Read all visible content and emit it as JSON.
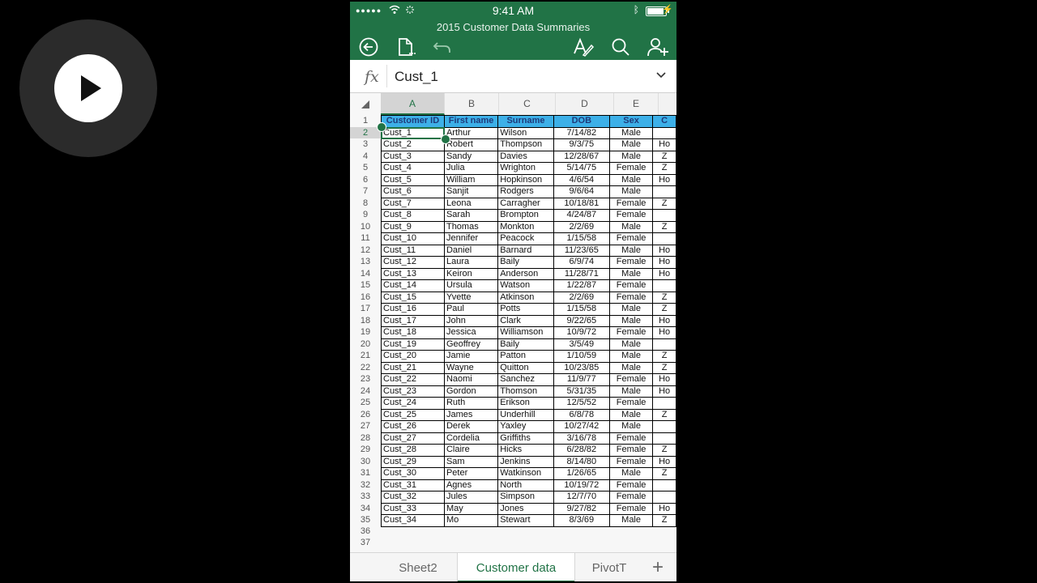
{
  "status": {
    "time": "9:41 AM",
    "signal": "●●●●●"
  },
  "document": {
    "title": "2015 Customer Data Summaries"
  },
  "toolbar": {
    "back": "back-arrow-icon",
    "file": "file-icon",
    "undo": "undo-icon",
    "format": "format-text-icon",
    "search": "search-icon",
    "share": "add-person-icon"
  },
  "formula_bar": {
    "fx_label": "fx",
    "value": "Cust_1"
  },
  "grid": {
    "columns": [
      "A",
      "B",
      "C",
      "D",
      "E",
      ""
    ],
    "header_row": [
      "Customer ID",
      "First name",
      "Surname",
      "DOB",
      "Sex",
      "C"
    ],
    "rows": [
      [
        "Cust_1",
        "Arthur",
        "Wilson",
        "7/14/82",
        "Male",
        ""
      ],
      [
        "Cust_2",
        "Robert",
        "Thompson",
        "9/3/75",
        "Male",
        "Ho"
      ],
      [
        "Cust_3",
        "Sandy",
        "Davies",
        "12/28/67",
        "Male",
        "Z"
      ],
      [
        "Cust_4",
        "Julia",
        "Wrighton",
        "5/14/75",
        "Female",
        "Z"
      ],
      [
        "Cust_5",
        "William",
        "Hopkinson",
        "4/6/54",
        "Male",
        "Ho"
      ],
      [
        "Cust_6",
        "Sanjit",
        "Rodgers",
        "9/6/64",
        "Male",
        ""
      ],
      [
        "Cust_7",
        "Leona",
        "Carragher",
        "10/18/81",
        "Female",
        "Z"
      ],
      [
        "Cust_8",
        "Sarah",
        "Brompton",
        "4/24/87",
        "Female",
        ""
      ],
      [
        "Cust_9",
        "Thomas",
        "Monkton",
        "2/2/69",
        "Male",
        "Z"
      ],
      [
        "Cust_10",
        "Jennifer",
        "Peacock",
        "1/15/58",
        "Female",
        ""
      ],
      [
        "Cust_11",
        "Daniel",
        "Barnard",
        "11/23/65",
        "Male",
        "Ho"
      ],
      [
        "Cust_12",
        "Laura",
        "Baily",
        "6/9/74",
        "Female",
        "Ho"
      ],
      [
        "Cust_13",
        "Keiron",
        "Anderson",
        "11/28/71",
        "Male",
        "Ho"
      ],
      [
        "Cust_14",
        "Ursula",
        "Watson",
        "1/22/87",
        "Female",
        ""
      ],
      [
        "Cust_15",
        "Yvette",
        "Atkinson",
        "2/2/69",
        "Female",
        "Z"
      ],
      [
        "Cust_16",
        "Paul",
        "Potts",
        "1/15/58",
        "Male",
        "Z"
      ],
      [
        "Cust_17",
        "John",
        "Clark",
        "9/22/65",
        "Male",
        "Ho"
      ],
      [
        "Cust_18",
        "Jessica",
        "Williamson",
        "10/9/72",
        "Female",
        "Ho"
      ],
      [
        "Cust_19",
        "Geoffrey",
        "Baily",
        "3/5/49",
        "Male",
        ""
      ],
      [
        "Cust_20",
        "Jamie",
        "Patton",
        "1/10/59",
        "Male",
        "Z"
      ],
      [
        "Cust_21",
        "Wayne",
        "Quitton",
        "10/23/85",
        "Male",
        "Z"
      ],
      [
        "Cust_22",
        "Naomi",
        "Sanchez",
        "11/9/77",
        "Female",
        "Ho"
      ],
      [
        "Cust_23",
        "Gordon",
        "Thomson",
        "5/31/35",
        "Male",
        "Ho"
      ],
      [
        "Cust_24",
        "Ruth",
        "Erikson",
        "12/5/52",
        "Female",
        ""
      ],
      [
        "Cust_25",
        "James",
        "Underhill",
        "6/8/78",
        "Male",
        "Z"
      ],
      [
        "Cust_26",
        "Derek",
        "Yaxley",
        "10/27/42",
        "Male",
        ""
      ],
      [
        "Cust_27",
        "Cordelia",
        "Griffiths",
        "3/16/78",
        "Female",
        ""
      ],
      [
        "Cust_28",
        "Claire",
        "Hicks",
        "6/28/82",
        "Female",
        "Z"
      ],
      [
        "Cust_29",
        "Sam",
        "Jenkins",
        "8/14/80",
        "Female",
        "Ho"
      ],
      [
        "Cust_30",
        "Peter",
        "Watkinson",
        "1/26/65",
        "Male",
        "Z"
      ],
      [
        "Cust_31",
        "Agnes",
        "North",
        "10/19/72",
        "Female",
        ""
      ],
      [
        "Cust_32",
        "Jules",
        "Simpson",
        "12/7/70",
        "Female",
        ""
      ],
      [
        "Cust_33",
        "May",
        "Jones",
        "9/27/82",
        "Female",
        "Ho"
      ],
      [
        "Cust_34",
        "Mo",
        "Stewart",
        "8/3/69",
        "Male",
        "Z"
      ]
    ],
    "row_numbers": [
      "1",
      "2",
      "3",
      "4",
      "5",
      "6",
      "7",
      "8",
      "9",
      "10",
      "11",
      "12",
      "13",
      "14",
      "15",
      "16",
      "17",
      "18",
      "19",
      "20",
      "21",
      "22",
      "23",
      "24",
      "25",
      "26",
      "27",
      "28",
      "29",
      "30",
      "31",
      "32",
      "33",
      "34",
      "35"
    ],
    "empty_rows": [
      "36",
      "37"
    ]
  },
  "sheet_tabs": [
    {
      "label": "Sheet2"
    },
    {
      "label": "Customer data"
    },
    {
      "label": "PivotT"
    }
  ],
  "add_sheet": "+",
  "colors": {
    "excel_green": "#217346",
    "header_fill": "#3db0e8",
    "header_text": "#1f3a7a"
  }
}
